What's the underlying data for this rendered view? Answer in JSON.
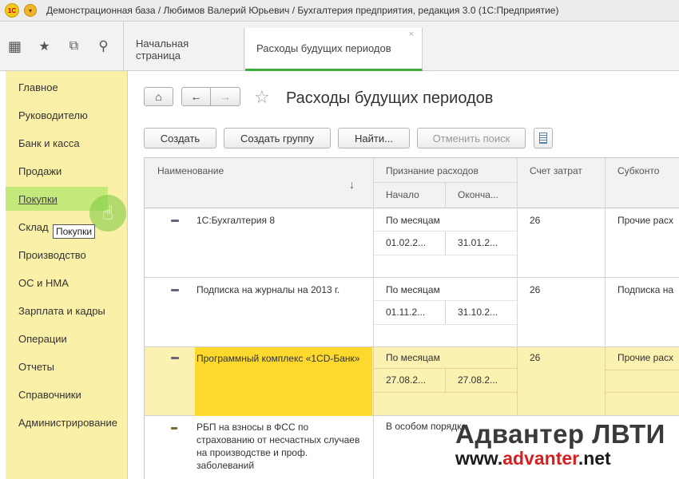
{
  "window": {
    "title": "Демонстрационная база / Любимов Валерий Юрьевич / Бухгалтерия предприятия, редакция 3.0  (1С:Предприятие)",
    "logo": "1С"
  },
  "tabs": [
    {
      "label": "Начальная страница"
    },
    {
      "label": "Расходы будущих периодов",
      "close": "×"
    }
  ],
  "icons": {
    "apps": "▦",
    "favorite": "★",
    "history": "⧉",
    "search": "⚲"
  },
  "sidebar": {
    "items": [
      {
        "label": "Главное"
      },
      {
        "label": "Руководителю"
      },
      {
        "label": "Банк и касса"
      },
      {
        "label": "Продажи"
      },
      {
        "label": "Покупки"
      },
      {
        "label": "Склад"
      },
      {
        "label": "Производство"
      },
      {
        "label": "ОС и НМА"
      },
      {
        "label": "Зарплата и кадры"
      },
      {
        "label": "Операции"
      },
      {
        "label": "Отчеты"
      },
      {
        "label": "Справочники"
      },
      {
        "label": "Администрирование"
      }
    ],
    "tooltip": "Покупки"
  },
  "page": {
    "title": "Расходы будущих периодов",
    "buttons": {
      "create": "Создать",
      "create_group": "Создать группу",
      "find": "Найти...",
      "cancel_search": "Отменить поиск"
    }
  },
  "table": {
    "headers": {
      "name": "Наименование",
      "sort_arrow": "↓",
      "recognition": "Признание расходов",
      "start": "Начало",
      "end": "Оконча...",
      "account": "Счет затрат",
      "subconto": "Субконто"
    },
    "rows": [
      {
        "name": "1С:Бухгалтерия 8",
        "method": "По месяцам",
        "start": "01.02.2...",
        "end": "31.01.2...",
        "account": "26",
        "subconto": "Прочие расх"
      },
      {
        "name": "Подписка на журналы на 2013 г.",
        "method": "По месяцам",
        "start": "01.11.2...",
        "end": "31.10.2...",
        "account": "26",
        "subconto": "Подписка на"
      },
      {
        "name": "Программный комплекс «1CD-Банк»",
        "method": "По месяцам",
        "start": "27.08.2...",
        "end": "27.08.2...",
        "account": "26",
        "subconto": "Прочие расх"
      },
      {
        "name": "РБП на взносы в ФСС по страхованию от несчастных случаев на производстве и проф. заболеваний",
        "method": "В особом порядке",
        "start": "",
        "end": "",
        "account": "",
        "subconto": ""
      }
    ]
  },
  "watermark": {
    "line1": "Адвантер ЛВТИ",
    "line2_a": "www.",
    "line2_b": "advanter",
    "line2_c": ".net"
  }
}
